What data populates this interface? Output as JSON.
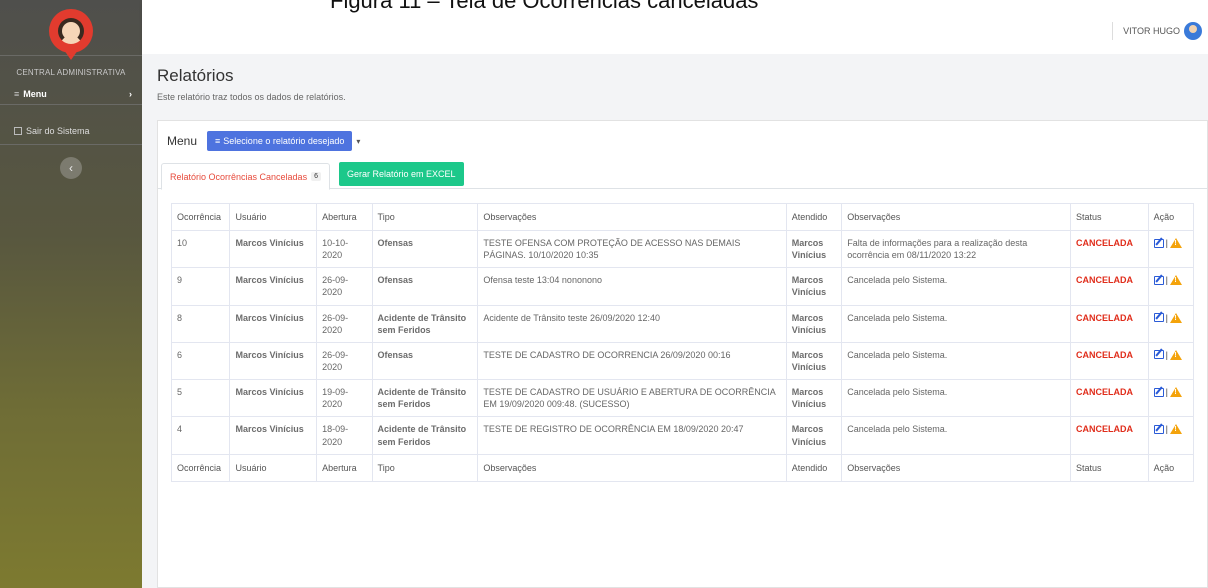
{
  "caption": "Figura 11 – Tela de Ocorrências canceladas",
  "sidebar": {
    "title": "CENTRAL ADMINISTRATIVA",
    "menu_label": "Menu",
    "menu_arrow": "›",
    "exit_label": "Sair do Sistema",
    "toggle": "‹"
  },
  "topbar": {
    "user_name": "VITOR HUGO"
  },
  "page": {
    "title": "Relatórios",
    "subtitle": "Este relatório traz todos os dados de relatórios."
  },
  "menu": {
    "label": "Menu",
    "select_button": "Selecione o relatório desejado",
    "caret": "▾"
  },
  "tabs": {
    "active_label": "Relatório Ocorrências Canceladas",
    "active_count": "6",
    "excel_button": "Gerar Relatório em EXCEL"
  },
  "table": {
    "headers": [
      "Ocorrência",
      "Usuário",
      "Abertura",
      "Tipo",
      "Observações",
      "Atendido",
      "Observações",
      "Status",
      "Ação"
    ],
    "rows": [
      {
        "id": "10",
        "usuario": "Marcos Vinícius",
        "abertura": "10-10-2020",
        "tipo": "Ofensas",
        "obs": "TESTE OFENSA COM PROTEÇÃO DE ACESSO NAS DEMAIS PÁGINAS. 10/10/2020 10:35",
        "atendido": "Marcos Vinícius",
        "obs2": "Falta de informações para a realização desta ocorrência em 08/11/2020 13:22",
        "status": "CANCELADA"
      },
      {
        "id": "9",
        "usuario": "Marcos Vinícius",
        "abertura": "26-09-2020",
        "tipo": "Ofensas",
        "obs": "Ofensa teste 13:04 nononono",
        "atendido": "Marcos Vinícius",
        "obs2": "Cancelada pelo Sistema.",
        "status": "CANCELADA"
      },
      {
        "id": "8",
        "usuario": "Marcos Vinícius",
        "abertura": "26-09-2020",
        "tipo": "Acidente de Trânsito sem Feridos",
        "obs": "Acidente de Trânsito teste 26/09/2020 12:40",
        "atendido": "Marcos Vinícius",
        "obs2": "Cancelada pelo Sistema.",
        "status": "CANCELADA"
      },
      {
        "id": "6",
        "usuario": "Marcos Vinícius",
        "abertura": "26-09-2020",
        "tipo": "Ofensas",
        "obs": "TESTE DE CADASTRO DE OCORRENCIA 26/09/2020 00:16",
        "atendido": "Marcos Vinícius",
        "obs2": "Cancelada pelo Sistema.",
        "status": "CANCELADA"
      },
      {
        "id": "5",
        "usuario": "Marcos Vinícius",
        "abertura": "19-09-2020",
        "tipo": "Acidente de Trânsito sem Feridos",
        "obs": "TESTE DE CADASTRO DE USUÁRIO E ABERTURA DE OCORRÊNCIA EM 19/09/2020 009:48. (SUCESSO)",
        "atendido": "Marcos Vinícius",
        "obs2": "Cancelada pelo Sistema.",
        "status": "CANCELADA"
      },
      {
        "id": "4",
        "usuario": "Marcos Vinícius",
        "abertura": "18-09-2020",
        "tipo": "Acidente de Trânsito sem Feridos",
        "obs": "TESTE DE REGISTRO DE OCORRÊNCIA EM 18/09/2020 20:47",
        "atendido": "Marcos Vinícius",
        "obs2": "Cancelada pelo Sistema.",
        "status": "CANCELADA"
      }
    ],
    "action_separator": "|",
    "icons": {
      "edit": "edit-icon",
      "warning": "warning-icon"
    }
  },
  "colors": {
    "accent": "#4e73df",
    "success": "#1cc88a",
    "danger": "#e02d1b",
    "warning": "#f4a30b"
  }
}
